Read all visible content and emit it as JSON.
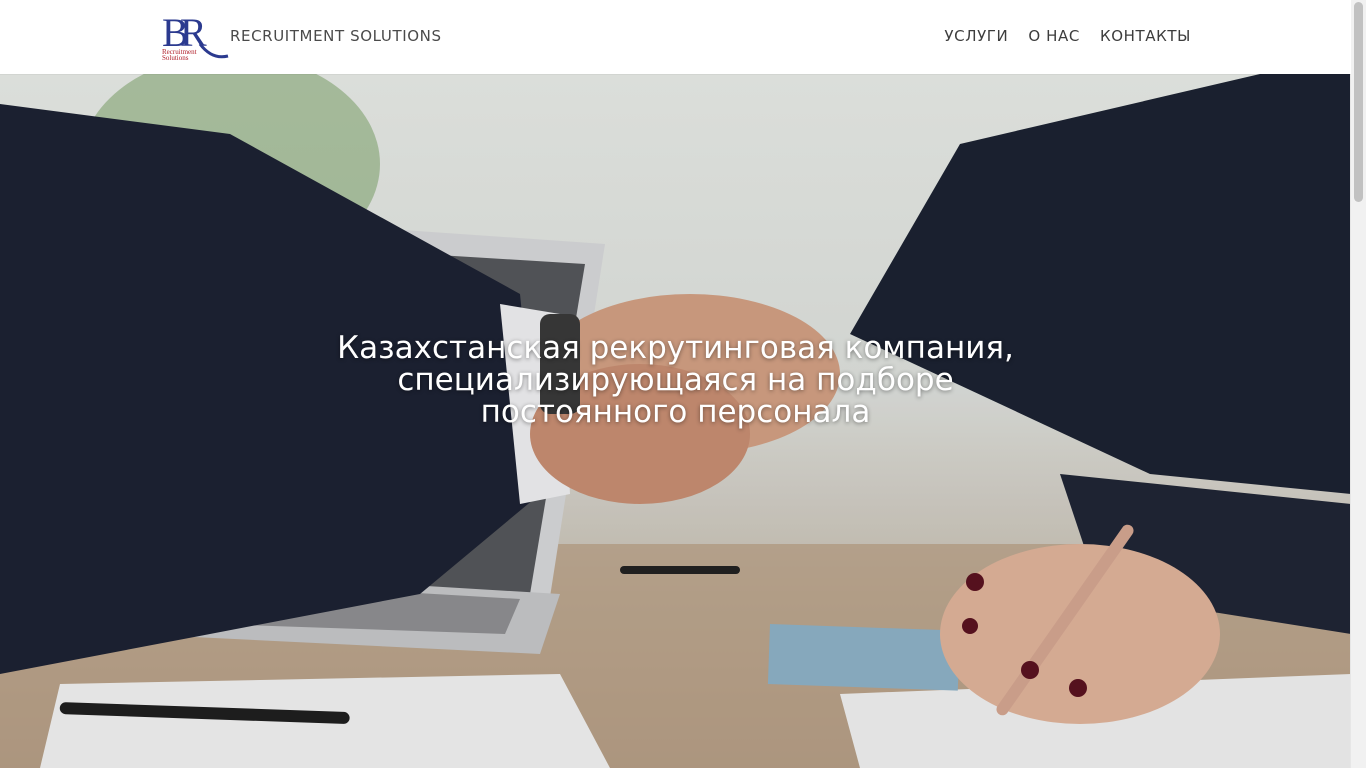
{
  "header": {
    "brand_name": "RECRUITMENT SOLUTIONS",
    "logo_text_line1": "Recruitment",
    "logo_text_line2": "Solutions",
    "nav": [
      {
        "label": "УСЛУГИ"
      },
      {
        "label": "О НАС"
      },
      {
        "label": "КОНТАКТЫ"
      }
    ]
  },
  "hero": {
    "title_lines": [
      "Казахстанская рекрутинговая компания,",
      "специализирующаяся на подборе",
      "постоянного персонала"
    ],
    "image_description_icon": "handshake-photo"
  },
  "colors": {
    "logo_blue": "#2b3a8f",
    "logo_red": "#b0202a",
    "nav_text": "#3d3d3d",
    "hero_text": "#ffffff"
  }
}
